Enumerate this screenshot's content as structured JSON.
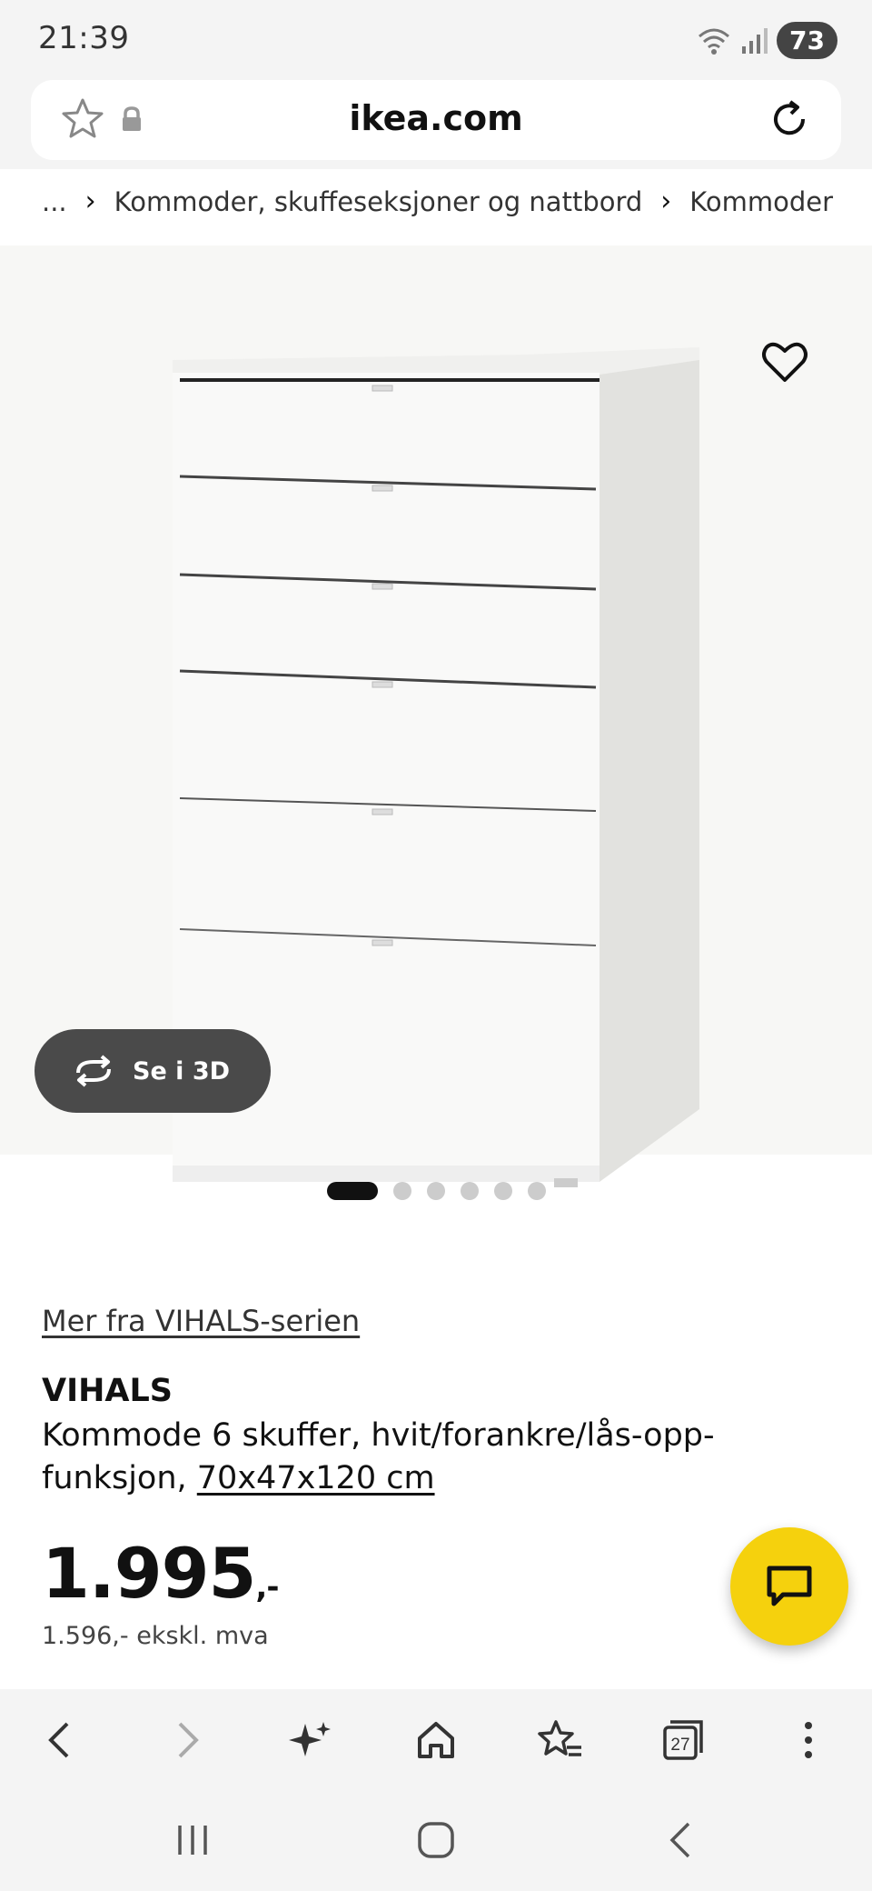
{
  "status_bar": {
    "time": "21:39",
    "battery": "73"
  },
  "browser": {
    "url": "ikea.com",
    "tabs_count": "27"
  },
  "breadcrumb": {
    "ellipsis": "...",
    "items": [
      "Kommoder, skuffeseksjoner og nattbord",
      "Kommoder"
    ]
  },
  "hero": {
    "see_3d_label": "Se i 3D",
    "image_count": 6,
    "active_image": 1
  },
  "product": {
    "series_link": "Mer fra VIHALS-serien",
    "name": "VIHALS",
    "description": "Kommode 6 skuffer, hvit/forankre/lås-opp-funksjon,",
    "dimensions": "70x47x120 cm",
    "price": "1.995",
    "price_suffix": ",-",
    "price_ex_vat": "1.596,- ekskl. mva"
  },
  "colors": {
    "accent_yellow": "#f5d10d",
    "dark_button": "#4a4a4a"
  },
  "icons": {
    "toolbar": [
      "back-icon",
      "forward-icon",
      "sparkle-icon",
      "home-icon",
      "bookmarks-icon",
      "tabs-icon",
      "more-icon"
    ],
    "nav": [
      "recents-icon",
      "home-nav-icon",
      "back-nav-icon"
    ]
  }
}
